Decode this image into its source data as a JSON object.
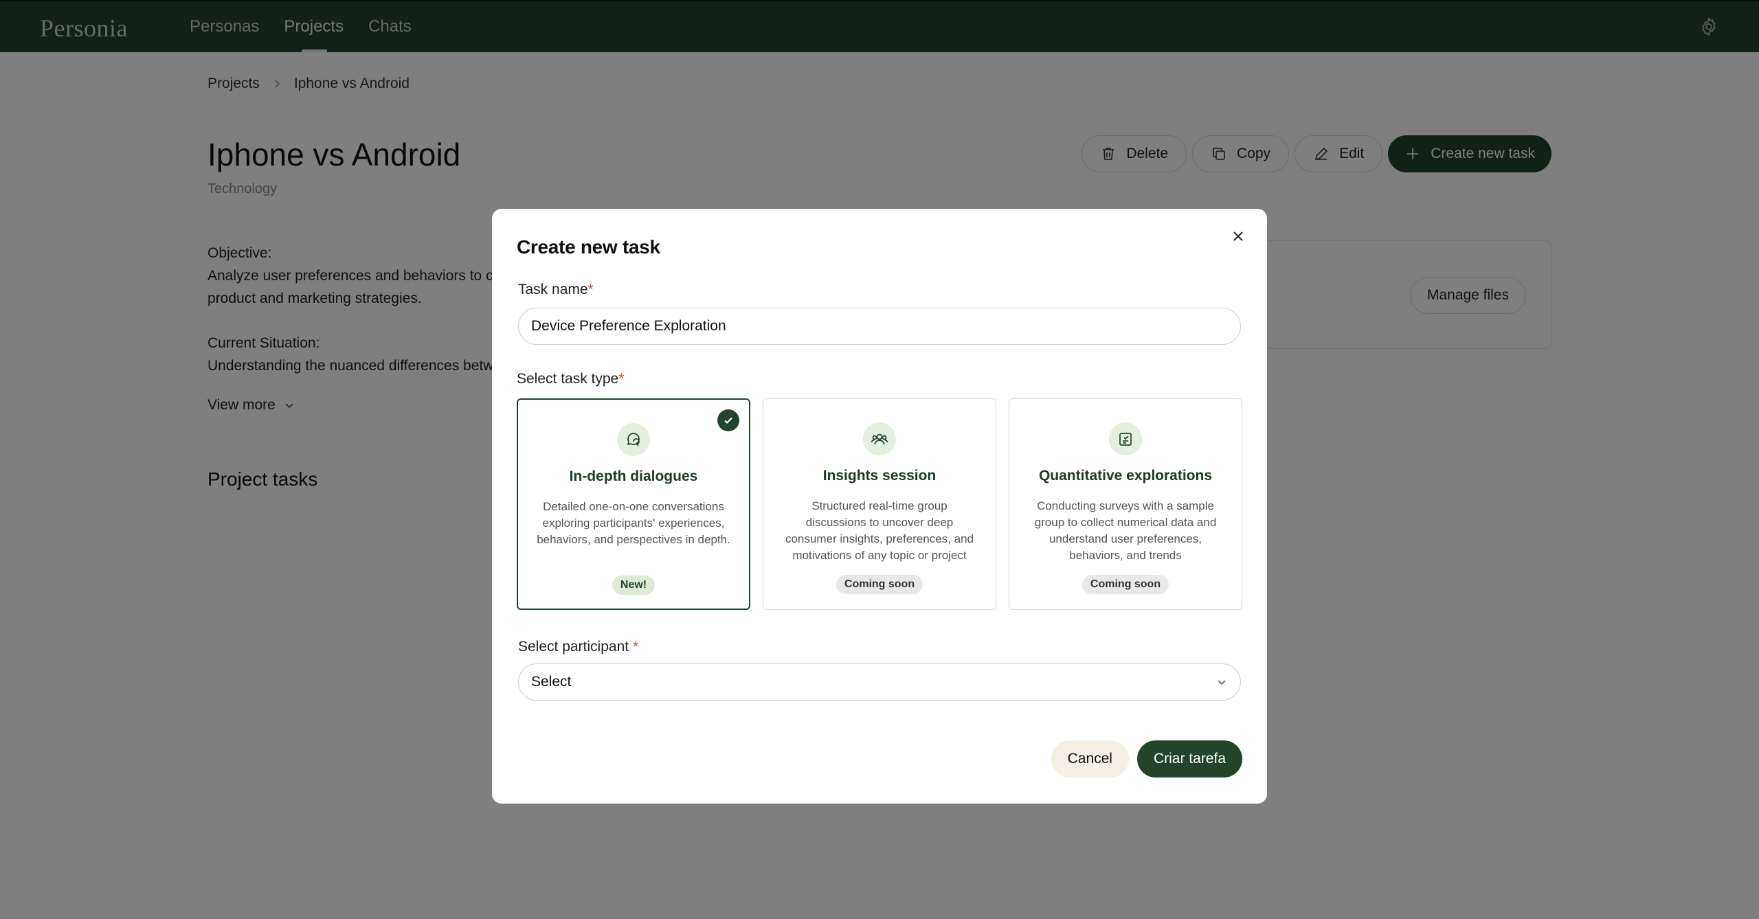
{
  "app": {
    "logo": "Personia",
    "nav": [
      {
        "label": "Personas"
      },
      {
        "label": "Projects"
      },
      {
        "label": "Chats"
      }
    ]
  },
  "breadcrumb": {
    "items": [
      "Projects",
      "Iphone vs Android"
    ]
  },
  "project": {
    "title": "Iphone vs Android",
    "category": "Technology",
    "objective_label": "Objective:",
    "objective_text": "Analyze user preferences and behaviors to co",
    "objective_text_2": "product and marketing strategies.",
    "situation_label": "Current Situation:",
    "situation_text": "Understanding the nuanced differences betwe",
    "view_more": "View more",
    "tasks_heading": "Project tasks"
  },
  "actions": {
    "delete": "Delete",
    "copy": "Copy",
    "edit": "Edit",
    "create": "Create new task"
  },
  "files": {
    "manage": "Manage files"
  },
  "modal": {
    "title": "Create new task",
    "task_name_label": "Task name",
    "task_name_value": "Device Preference Exploration",
    "task_type_label": "Select task type",
    "required_mark": "*",
    "task_types": [
      {
        "title": "In-depth dialogues",
        "description": "Detailed one-on-one conversations exploring participants' experiences, behaviors, and perspectives in depth.",
        "badge": "New!",
        "icon": "chat-bubble-icon",
        "selected": true
      },
      {
        "title": "Insights session",
        "description": "Structured real-time group discussions to uncover deep consumer insights, preferences, and motivations of any topic or project",
        "badge": "Coming soon",
        "icon": "group-icon",
        "selected": false
      },
      {
        "title": "Quantitative explorations",
        "description": "Conducting surveys with a sample group to collect numerical data and understand user preferences, behaviors, and trends",
        "badge": "Coming soon",
        "icon": "survey-icon",
        "selected": false
      }
    ],
    "participant_label": "Select participant ",
    "participant_value": "Select",
    "cancel": "Cancel",
    "submit": "Criar tarefa"
  },
  "colors": {
    "brand": "#23432a",
    "required": "#d94040",
    "badge_new_bg": "#dcebd4"
  }
}
